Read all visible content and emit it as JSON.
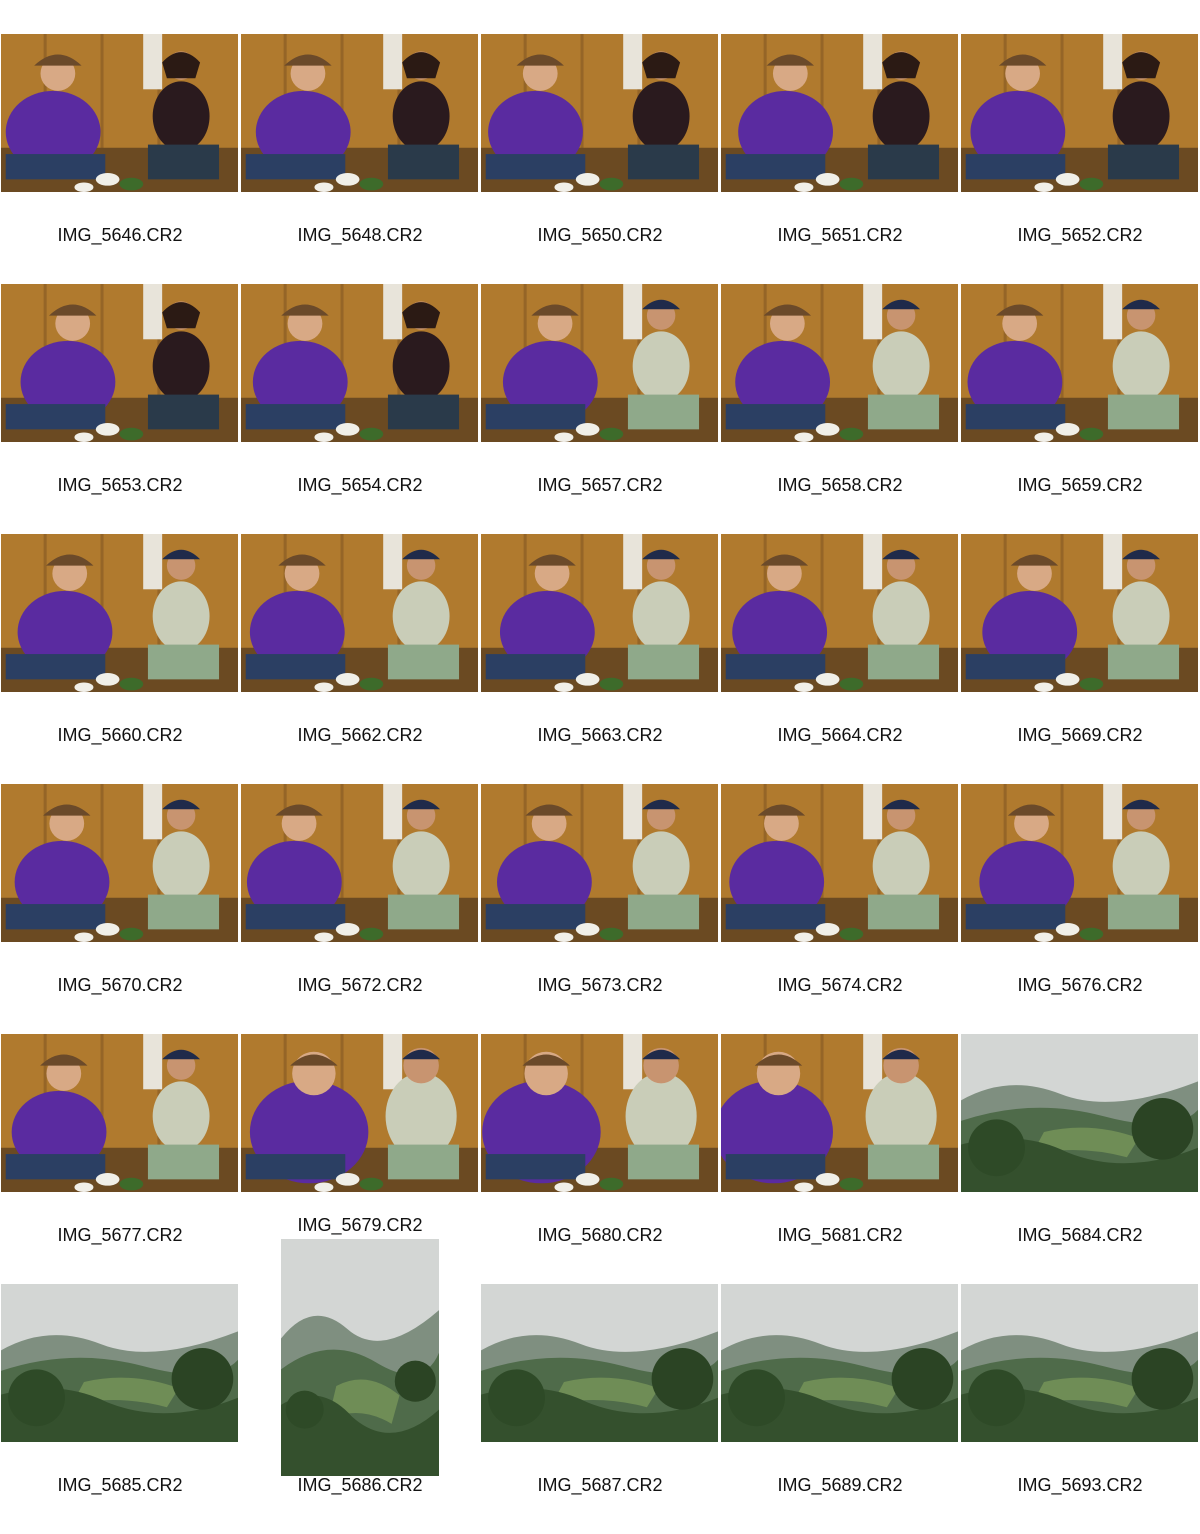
{
  "contact_sheet": {
    "background": "#ffffff",
    "thumbnails": [
      {
        "filename": "IMG_5646.CR2",
        "scene": "indoor-woman"
      },
      {
        "filename": "IMG_5648.CR2",
        "scene": "indoor-woman"
      },
      {
        "filename": "IMG_5650.CR2",
        "scene": "indoor-woman"
      },
      {
        "filename": "IMG_5651.CR2",
        "scene": "indoor-woman"
      },
      {
        "filename": "IMG_5652.CR2",
        "scene": "indoor-woman"
      },
      {
        "filename": "IMG_5653.CR2",
        "scene": "indoor-woman"
      },
      {
        "filename": "IMG_5654.CR2",
        "scene": "indoor-woman"
      },
      {
        "filename": "IMG_5657.CR2",
        "scene": "indoor-man"
      },
      {
        "filename": "IMG_5658.CR2",
        "scene": "indoor-man"
      },
      {
        "filename": "IMG_5659.CR2",
        "scene": "indoor-man"
      },
      {
        "filename": "IMG_5660.CR2",
        "scene": "indoor-man"
      },
      {
        "filename": "IMG_5662.CR2",
        "scene": "indoor-man"
      },
      {
        "filename": "IMG_5663.CR2",
        "scene": "indoor-man"
      },
      {
        "filename": "IMG_5664.CR2",
        "scene": "indoor-man"
      },
      {
        "filename": "IMG_5669.CR2",
        "scene": "indoor-man"
      },
      {
        "filename": "IMG_5670.CR2",
        "scene": "indoor-man"
      },
      {
        "filename": "IMG_5672.CR2",
        "scene": "indoor-man"
      },
      {
        "filename": "IMG_5673.CR2",
        "scene": "indoor-man"
      },
      {
        "filename": "IMG_5674.CR2",
        "scene": "indoor-man"
      },
      {
        "filename": "IMG_5676.CR2",
        "scene": "indoor-man"
      },
      {
        "filename": "IMG_5677.CR2",
        "scene": "indoor-man"
      },
      {
        "filename": "IMG_5679.CR2",
        "scene": "indoor-closeup"
      },
      {
        "filename": "IMG_5680.CR2",
        "scene": "indoor-closeup"
      },
      {
        "filename": "IMG_5681.CR2",
        "scene": "indoor-closeup"
      },
      {
        "filename": "IMG_5684.CR2",
        "scene": "landscape"
      },
      {
        "filename": "IMG_5685.CR2",
        "scene": "landscape"
      },
      {
        "filename": "IMG_5686.CR2",
        "scene": "landscape-portrait"
      },
      {
        "filename": "IMG_5687.CR2",
        "scene": "landscape"
      },
      {
        "filename": "IMG_5689.CR2",
        "scene": "landscape"
      },
      {
        "filename": "IMG_5693.CR2",
        "scene": "landscape"
      }
    ]
  },
  "colors": {
    "wood": "#b07a2e",
    "purple_shirt": "#5a2ba0",
    "tea_green": "#3d6b2a",
    "sky": "#cfd3d2",
    "hills": "#4f6b4a"
  }
}
